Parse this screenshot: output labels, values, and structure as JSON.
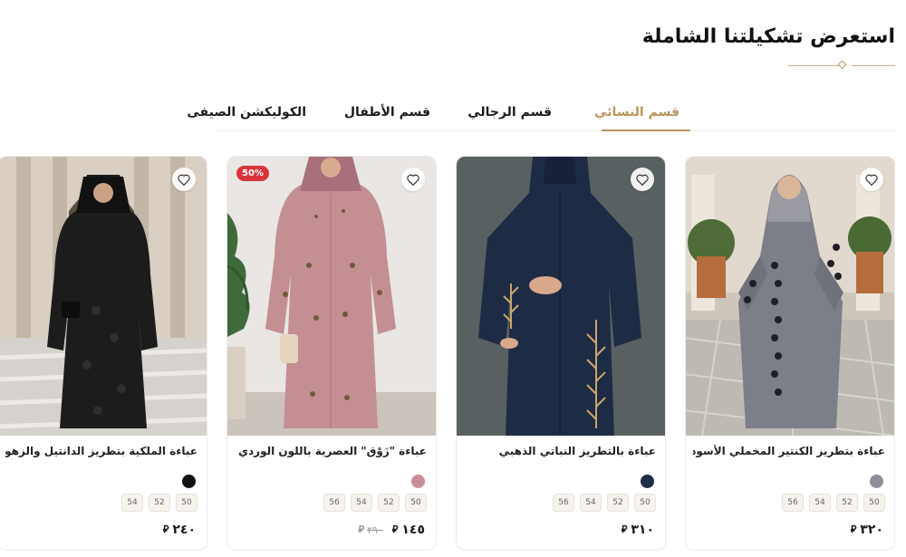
{
  "section": {
    "title": "استعرض تشكيلتنا الشاملة"
  },
  "tabs": [
    {
      "label": "قسم النسائي",
      "active": true
    },
    {
      "label": "قسم الرجالي",
      "active": false
    },
    {
      "label": "قسم الأطفال",
      "active": false
    },
    {
      "label": "الكوليكشن الصيفى",
      "active": false
    }
  ],
  "currency_icon": "riyal-icon",
  "currency_symbol": "⃁",
  "products": [
    {
      "name": "عباءة بتطريز الكنتير المخملي الأسود",
      "color": "#8f8f99",
      "sizes": [
        "50",
        "52",
        "54",
        "56"
      ],
      "price": "٣٢٠",
      "old_price": "",
      "badge": ""
    },
    {
      "name": "عباءة بالتطريز النباتي الذهبي",
      "color": "#1e2b45",
      "sizes": [
        "50",
        "52",
        "54",
        "56"
      ],
      "price": "٣١٠",
      "old_price": "",
      "badge": ""
    },
    {
      "name": "عباءة \"زَوْق\" العصرية باللون الوردي المطفي",
      "color": "#c98d98",
      "sizes": [
        "50",
        "52",
        "54",
        "56"
      ],
      "price": "١٤٥",
      "old_price": "٢٩٠",
      "badge": "50%"
    },
    {
      "name": "عباءة الملكية بتطريز الدانتيل والزهور البارزة",
      "color": "#111111",
      "sizes": [
        "50",
        "52",
        "54"
      ],
      "price": "٢٤٠",
      "old_price": "",
      "badge": ""
    }
  ]
}
